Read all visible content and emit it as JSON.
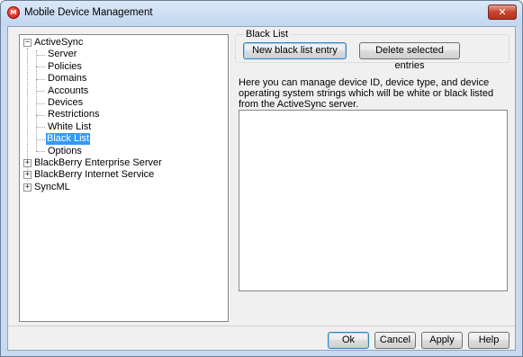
{
  "window": {
    "title": "Mobile Device Management",
    "app_icon_glyph": "M",
    "close_glyph": "✕"
  },
  "tree": {
    "items": [
      {
        "label": "ActiveSync",
        "expander": "−"
      },
      {
        "label": "Server"
      },
      {
        "label": "Policies"
      },
      {
        "label": "Domains"
      },
      {
        "label": "Accounts"
      },
      {
        "label": "Devices"
      },
      {
        "label": "Restrictions"
      },
      {
        "label": "White List"
      },
      {
        "label": "Black List",
        "selected": true
      },
      {
        "label": "Options"
      },
      {
        "label": "BlackBerry Enterprise Server",
        "expander": "+"
      },
      {
        "label": "BlackBerry Internet Service",
        "expander": "+"
      },
      {
        "label": "SyncML",
        "expander": "+"
      }
    ]
  },
  "blacklist": {
    "group_label": "Black List",
    "new_button": "New black list entry",
    "delete_button": "Delete selected entries",
    "description": "Here you can manage device ID, device type, and device operating system strings which will be white or black listed from the ActiveSync server."
  },
  "footer": {
    "ok": "Ok",
    "cancel": "Cancel",
    "apply": "Apply",
    "help": "Help"
  },
  "colors": {
    "selection": "#3399ff",
    "titlebar": "#c3d6ee",
    "close_button": "#c8452d"
  }
}
